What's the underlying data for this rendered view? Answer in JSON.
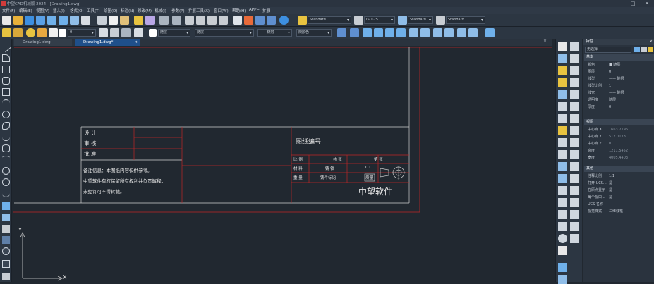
{
  "titlebar": {
    "title": "中望CAD机械版 2024 - [Drawing1.dwg]",
    "min": "—",
    "max": "□",
    "close": "✕"
  },
  "menu": {
    "items": [
      "文件(F)",
      "编辑(E)",
      "视图(V)",
      "插入(I)",
      "格式(O)",
      "工具(T)",
      "绘图(D)",
      "标注(N)",
      "修改(M)",
      "机械(J)",
      "参数(P)",
      "扩展工具(X)",
      "窗口(W)",
      "帮助(H)",
      "APP+",
      "扩展"
    ]
  },
  "toolbar": {
    "text_style": "Standard",
    "dim_style": "ISO-25",
    "table_style": "Standard",
    "multileader_style": "Standard",
    "layer": "0",
    "color": "随层",
    "linetype": "随层",
    "lineweight": "—— 随层",
    "plotstyle": "随颜色"
  },
  "tabs": {
    "start": "Drawing1.dwg",
    "active": "Drawing1.dwg*"
  },
  "drawing": {
    "design_label": "设  计",
    "check_label": "审  核",
    "approve_label": "批  准",
    "note_line1": "备注信息：本图纸内容仅供参考。",
    "note_line2": "中望软件有权保留所有权利并负责解释，",
    "note_line3": "未经许可不得转载。",
    "drawing_no_label": "图纸编号",
    "ratio_label": "比 例",
    "sheets_label": "共    张",
    "sheet_label": "第    张",
    "material_label": "材 料",
    "material_value": "铸 铁",
    "qty_label": "数 量",
    "qty_value": "数 量",
    "scale_value": "1:1",
    "weight_label": "重 量",
    "weight_value": "铸件标记",
    "unit_value": "质量",
    "company": "中望软件",
    "axis_x": "X",
    "axis_y": "Y"
  },
  "props": {
    "title": "特性",
    "selector": "无选择",
    "section_general": "基本",
    "general": [
      {
        "k": "颜色",
        "v": "■ 随层"
      },
      {
        "k": "图层",
        "v": "0"
      },
      {
        "k": "线型",
        "v": "—— 随层"
      },
      {
        "k": "线型比例",
        "v": "1"
      },
      {
        "k": "线宽",
        "v": "—— 随层"
      },
      {
        "k": "透明度",
        "v": "随层"
      },
      {
        "k": "厚度",
        "v": "0"
      }
    ],
    "section_view": "视图",
    "view": [
      {
        "k": "中心点 X",
        "v": "1663.7196"
      },
      {
        "k": "中心点 Y",
        "v": "512.0178"
      },
      {
        "k": "中心点 Z",
        "v": "0"
      },
      {
        "k": "高度",
        "v": "1211.5452"
      },
      {
        "k": "宽度",
        "v": "4005.4403"
      }
    ],
    "section_misc": "其他",
    "misc": [
      {
        "k": "注释比例",
        "v": "1:1"
      },
      {
        "k": "打开 UCS...",
        "v": "是"
      },
      {
        "k": "在原点显示",
        "v": "是"
      },
      {
        "k": "每个视口...",
        "v": "是"
      },
      {
        "k": "UCS 名称",
        "v": ""
      },
      {
        "k": "视觉样式",
        "v": "二维线框"
      }
    ]
  }
}
